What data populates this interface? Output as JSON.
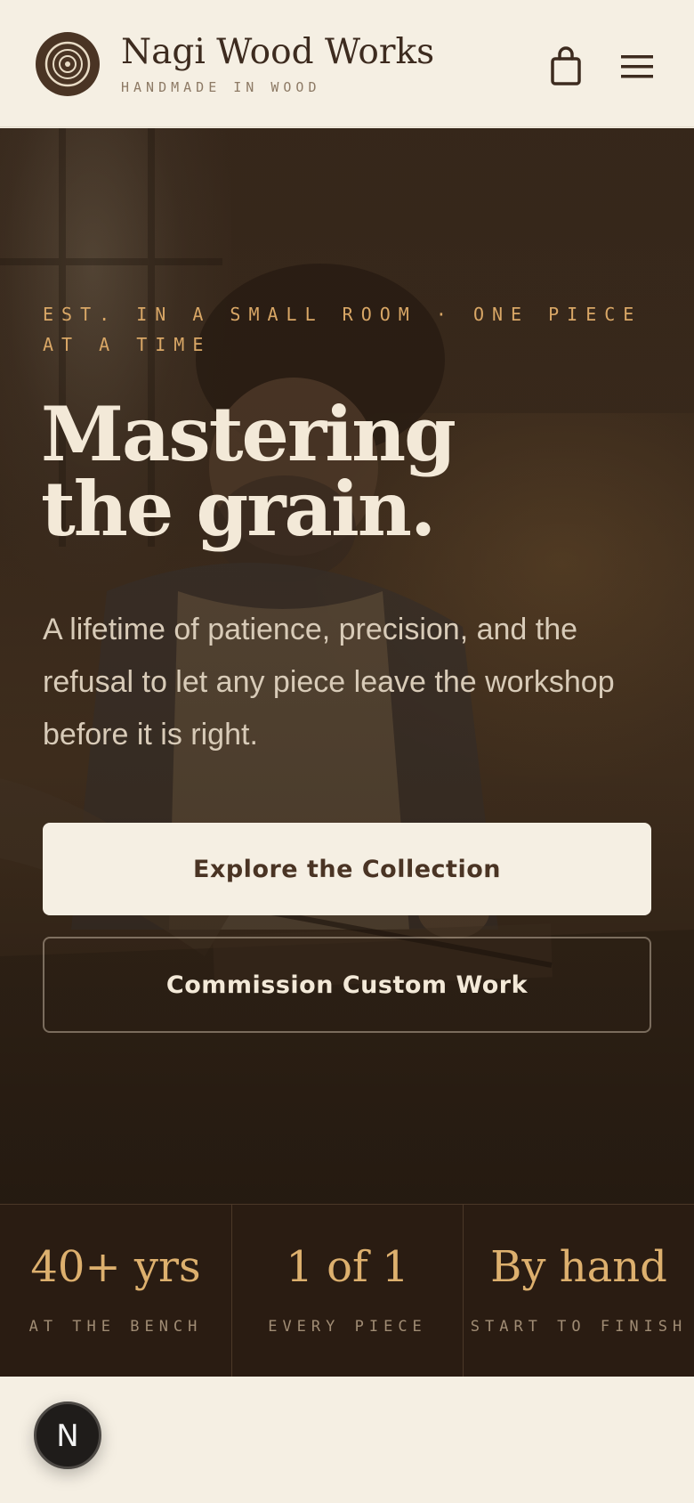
{
  "header": {
    "brand_name": "Nagi Wood Works",
    "brand_tagline": "HANDMADE IN WOOD",
    "logo_icon": "wood-rings-icon",
    "cart_icon": "shopping-bag-icon",
    "menu_icon": "hamburger-menu-icon"
  },
  "hero": {
    "eyebrow": "EST. IN A SMALL ROOM · ONE PIECE AT A TIME",
    "headline_line1": "Mastering",
    "headline_line2": "the grain.",
    "lede": "A lifetime of patience, precision, and the refusal to let any piece leave the workshop before it is right.",
    "primary_cta": "Explore the Collection",
    "secondary_cta": "Commission Custom Work"
  },
  "stats": [
    {
      "value": "40+ yrs",
      "label": "AT THE BENCH"
    },
    {
      "value": "1 of 1",
      "label": "EVERY PIECE"
    },
    {
      "value": "By hand",
      "label": "START TO FINISH"
    }
  ],
  "fab": {
    "label": "N"
  },
  "colors": {
    "cream": "#f5efe3",
    "dark_brown": "#3d2b1f",
    "accent_gold": "#d9a766",
    "stats_bg": "#2a1c12"
  }
}
